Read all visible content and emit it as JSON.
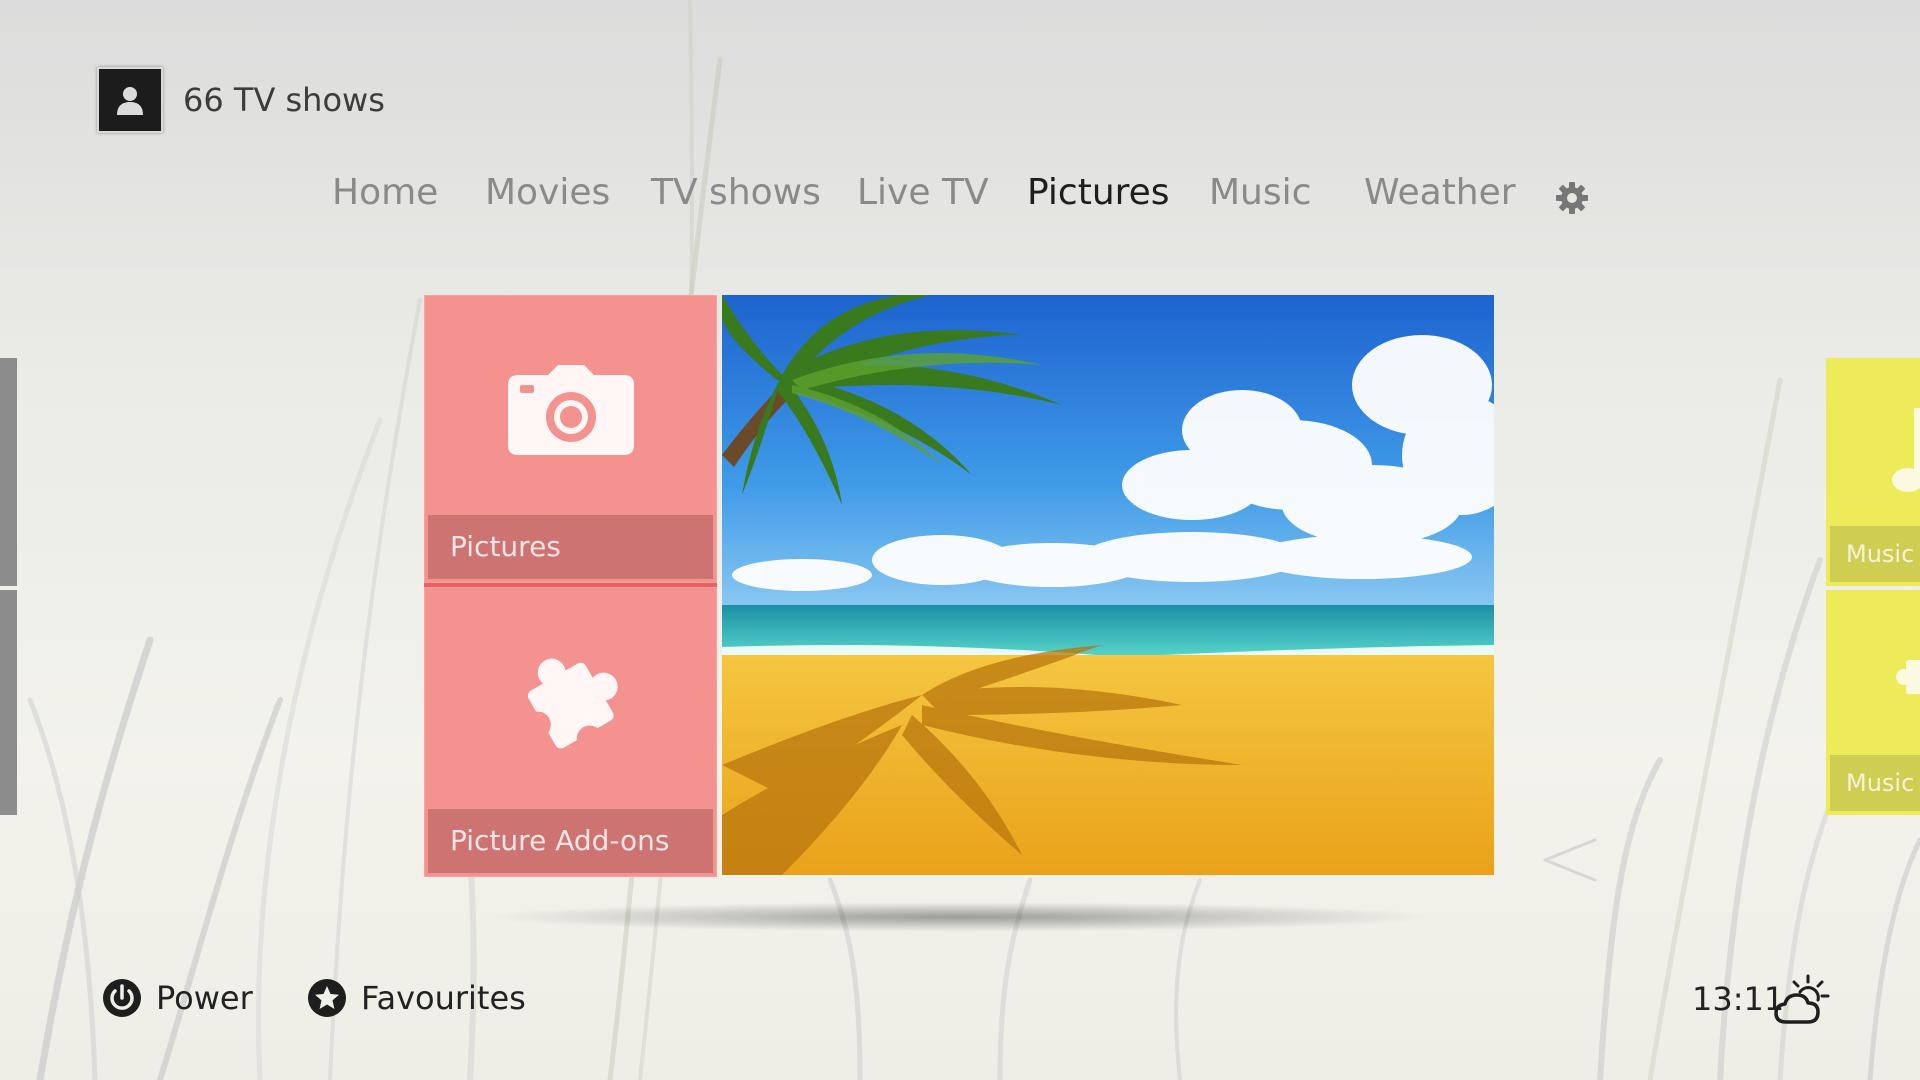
{
  "header": {
    "profile_label": "66 TV shows",
    "avatar_icon": "user-silhouette-icon"
  },
  "nav": {
    "items": [
      {
        "label": "Home",
        "active": false
      },
      {
        "label": "Movies",
        "active": false
      },
      {
        "label": "TV shows",
        "active": false
      },
      {
        "label": "Live TV",
        "active": false
      },
      {
        "label": "Pictures",
        "active": true
      },
      {
        "label": "Music",
        "active": false
      },
      {
        "label": "Weather",
        "active": false
      }
    ],
    "settings_icon": "gear-icon"
  },
  "tiles": {
    "pictures": {
      "label": "Pictures",
      "icon": "camera-icon"
    },
    "addons": {
      "label": "Picture Add-ons",
      "icon": "puzzle-piece-icon"
    },
    "accent_color": "#f49290"
  },
  "preview": {
    "image": "tropical beach with palm tree"
  },
  "side_tiles": {
    "music": {
      "label": "Music",
      "icon": "music-note-icon"
    },
    "music_addons": {
      "label": "Music Ac",
      "icon": "puzzle-piece-icon"
    },
    "accent_color": "#eeeb5a"
  },
  "footer": {
    "power_label": "Power",
    "favourites_label": "Favourites",
    "clock": "13:11",
    "weather_icon": "partly-cloudy-icon"
  }
}
